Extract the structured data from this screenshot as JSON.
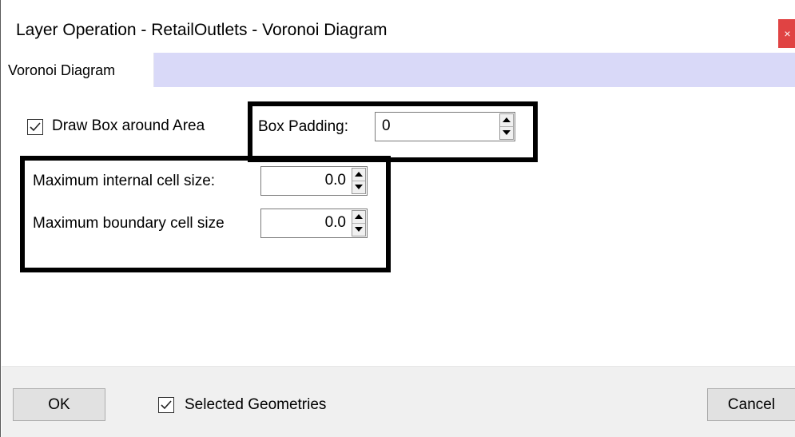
{
  "window": {
    "title": "Layer Operation - RetailOutlets - Voronoi Diagram",
    "close_glyph": "×"
  },
  "tabs": [
    {
      "label": "Voronoi Diagram",
      "active": true
    }
  ],
  "options": {
    "draw_box": {
      "label": "Draw Box around Area",
      "checked": true
    },
    "box_padding": {
      "label": "Box Padding:",
      "value": "0"
    },
    "max_internal": {
      "label": "Maximum internal cell size:",
      "value": "0.0"
    },
    "max_boundary": {
      "label": "Maximum boundary cell size",
      "value": "0.0"
    }
  },
  "footer": {
    "ok_label": "OK",
    "selected_geometries": {
      "label": "Selected Geometries",
      "checked": true
    },
    "cancel_label": "Cancel"
  },
  "colors": {
    "tab_strip": "#d9d9f8",
    "close_button": "#e04343",
    "footer": "#f0f0f0",
    "highlight": "#000000"
  }
}
